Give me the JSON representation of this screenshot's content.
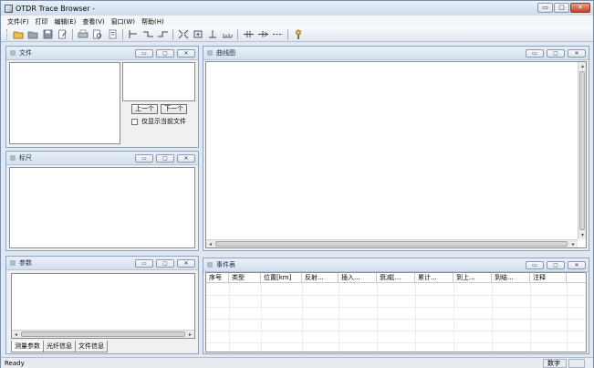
{
  "window": {
    "title": "OTDR Trace Browser -",
    "min": "▭",
    "max": "▢",
    "close": "✕"
  },
  "menu": [
    "文件(F)",
    "打印",
    "编辑(E)",
    "查看(V)",
    "窗口(W)",
    "帮助(H)"
  ],
  "panels": {
    "file": {
      "title": "文件",
      "prev": "上一个",
      "next": "下一个",
      "checkbox": "仅显示当前文件"
    },
    "ruler": {
      "title": "标尺"
    },
    "params": {
      "title": "参数",
      "tabs": [
        "测量参数",
        "光纤信息",
        "文件信息"
      ]
    },
    "curve": {
      "title": "曲线图"
    },
    "events": {
      "title": "事件表",
      "columns": [
        "序号",
        "类型",
        "位置[km]",
        "反射...",
        "插入...",
        "衰减[...",
        "累计...",
        "到上...",
        "到结...",
        "注释"
      ]
    }
  },
  "status": {
    "text": "Ready",
    "cell": "数字"
  }
}
